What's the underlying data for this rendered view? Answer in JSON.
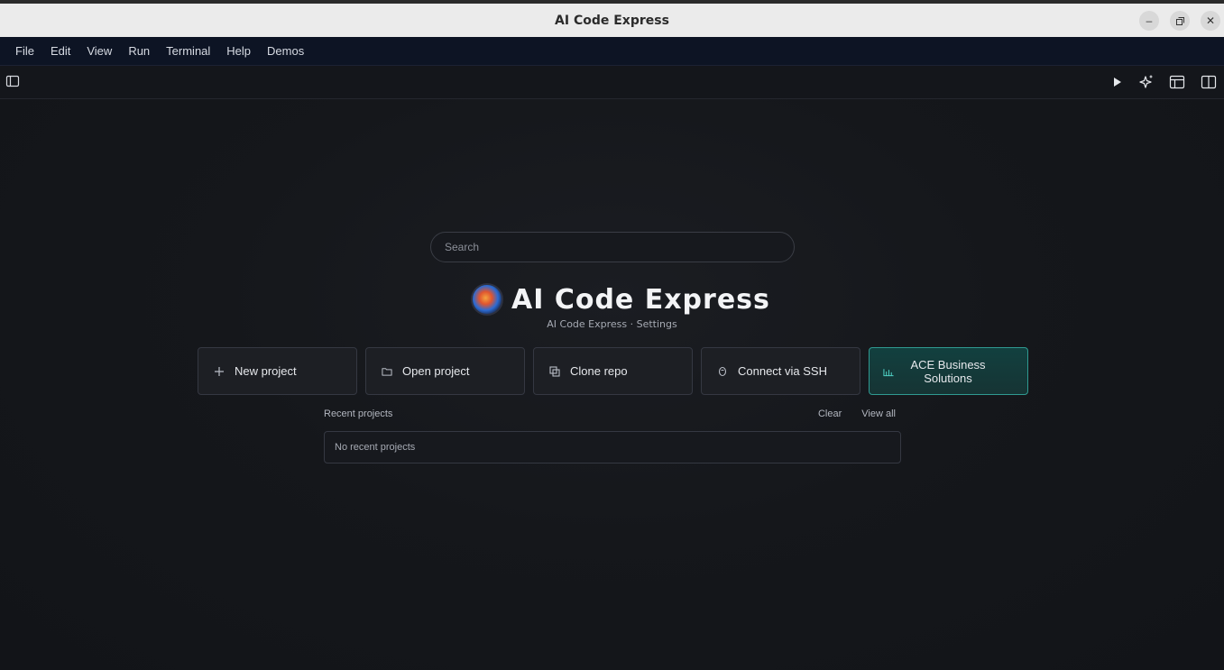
{
  "window": {
    "title": "AI Code Express"
  },
  "menu": [
    "File",
    "Edit",
    "View",
    "Run",
    "Terminal",
    "Help",
    "Demos"
  ],
  "search": {
    "placeholder": "Search"
  },
  "brand": {
    "name": "AI Code Express",
    "subtitle": "AI Code Express · Settings"
  },
  "actions": {
    "new_project": "New project",
    "open_project": "Open project",
    "clone_repo": "Clone repo",
    "connect_ssh": "Connect via SSH",
    "business": "ACE Business Solutions"
  },
  "recent": {
    "label": "Recent projects",
    "clear": "Clear",
    "view_all": "View all",
    "empty": "No recent projects"
  },
  "colors": {
    "accent": "#2f9a91",
    "menubar": "#0d1424",
    "background": "#13151a"
  }
}
